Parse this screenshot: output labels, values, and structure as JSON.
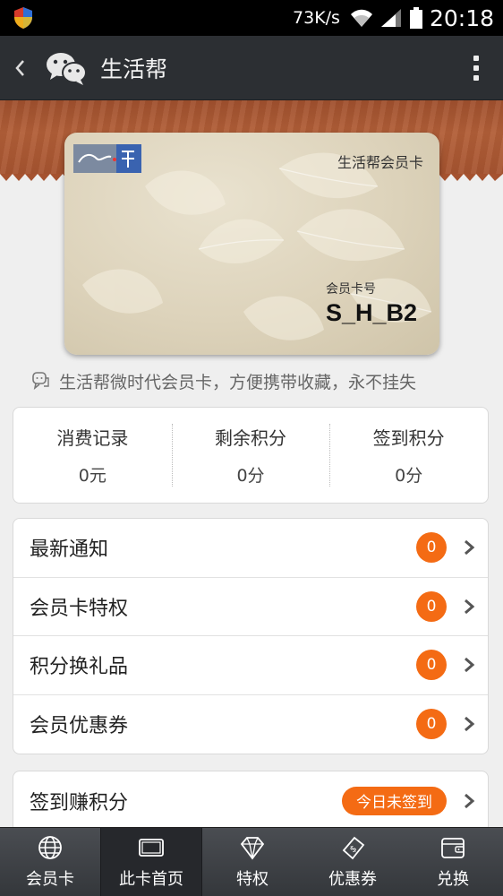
{
  "status_bar": {
    "speed": "73K/s",
    "time": "20:18"
  },
  "header": {
    "title": "生活帮",
    "back_icon": "chevron-left-icon",
    "logo_icon": "wechat-icon",
    "more_icon": "overflow-menu-icon"
  },
  "card": {
    "title": "生活帮会员卡",
    "number_label": "会员卡号",
    "number_value": "S_H_B2"
  },
  "tagline": "生活帮微时代会员卡，方便携带收藏，永不挂失",
  "stats": [
    {
      "label": "消费记录",
      "value": "0元"
    },
    {
      "label": "剩余积分",
      "value": "0分"
    },
    {
      "label": "签到积分",
      "value": "0分"
    }
  ],
  "menu": [
    {
      "label": "最新通知",
      "badge": "0"
    },
    {
      "label": "会员卡特权",
      "badge": "0"
    },
    {
      "label": "积分换礼品",
      "badge": "0"
    },
    {
      "label": "会员优惠券",
      "badge": "0"
    }
  ],
  "checkin": {
    "label": "签到赚积分",
    "status": "今日未签到"
  },
  "tabs": [
    {
      "label": "会员卡",
      "icon": "globe-icon"
    },
    {
      "label": "此卡首页",
      "icon": "card-icon"
    },
    {
      "label": "特权",
      "icon": "diamond-icon"
    },
    {
      "label": "优惠券",
      "icon": "coupon-icon"
    },
    {
      "label": "兑换",
      "icon": "wallet-icon"
    }
  ],
  "colors": {
    "accent": "#f46b14",
    "header_bg": "#2c2f33",
    "wood": "#a5522f"
  }
}
